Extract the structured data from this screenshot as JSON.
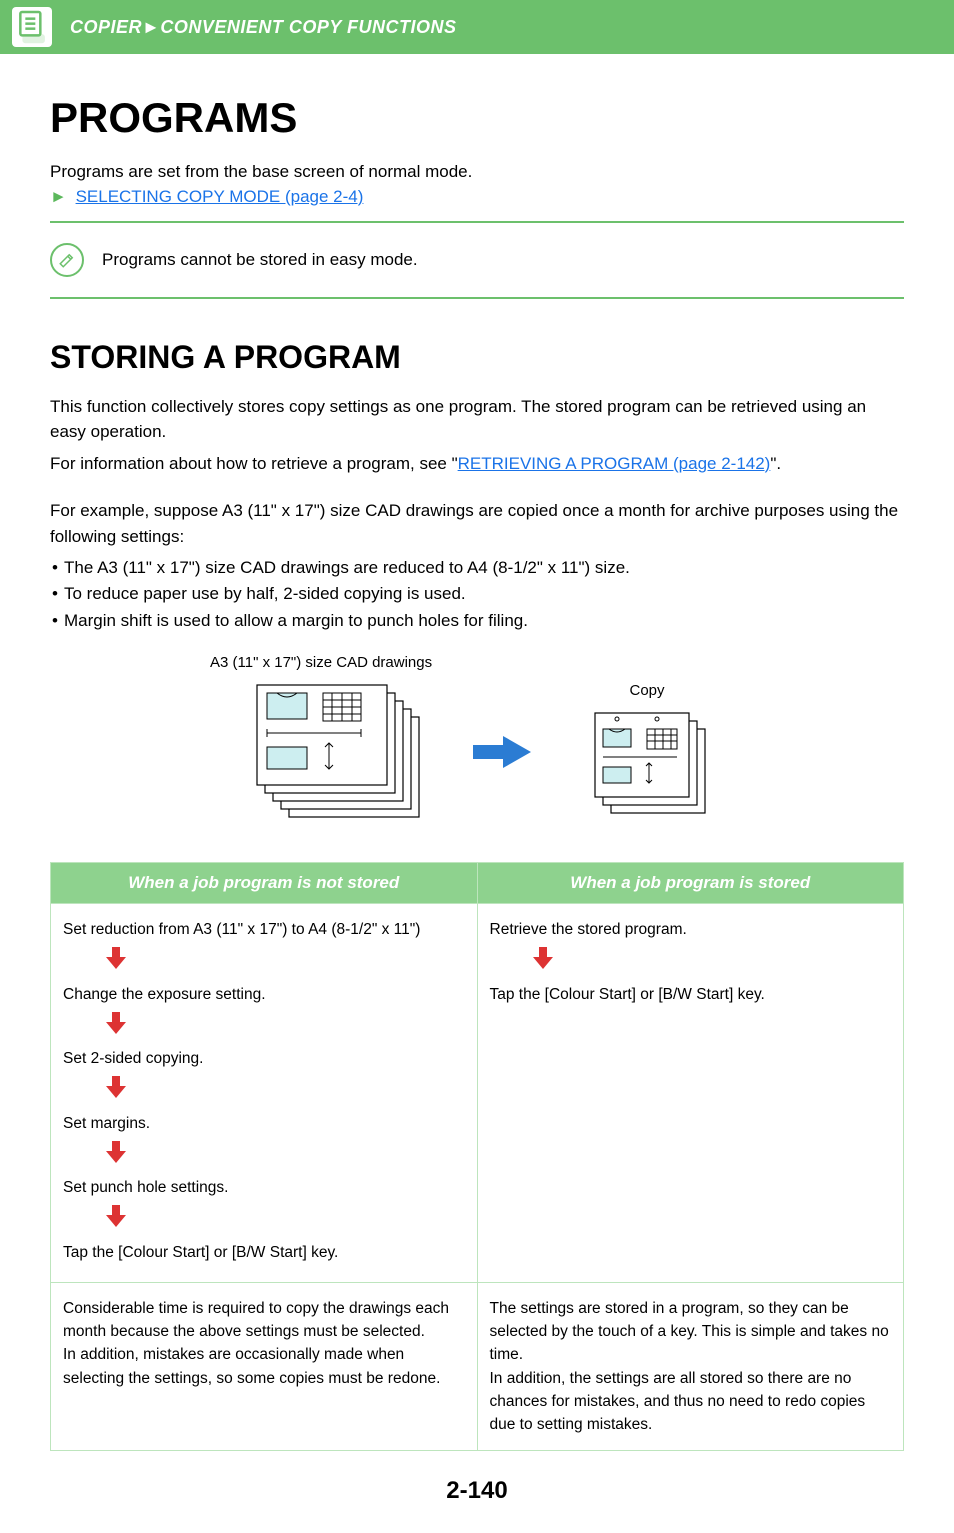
{
  "header": {
    "breadcrumb_parent": "COPIER",
    "breadcrumb_sep": "►",
    "breadcrumb_child": "CONVENIENT COPY FUNCTIONS"
  },
  "title": "PROGRAMS",
  "intro": "Programs are set from the base screen of normal mode.",
  "link_prefix": "►",
  "link_text": "SELECTING COPY MODE (page 2-4)",
  "note": "Programs cannot be stored in easy mode.",
  "section_title": "STORING A PROGRAM",
  "para1": "This function collectively stores copy settings as one program.  The stored program can be retrieved using an easy operation.",
  "para2_prefix": "For information about how to retrieve a program, see \"",
  "para2_link": "RETRIEVING A PROGRAM (page 2-142)",
  "para2_suffix": "\".",
  "example_intro": "For example, suppose A3 (11\" x 17\") size CAD drawings are copied once a month for archive purposes using the following settings:",
  "bullets": [
    "The A3 (11\" x 17\") size CAD drawings are reduced to A4 (8-1/2\" x 11\") size.",
    "To reduce paper use by half, 2-sided copying is used.",
    "Margin shift is used to allow a margin to punch holes for filing."
  ],
  "diagram": {
    "caption_left": "A3 (11\" x 17\") size CAD drawings",
    "caption_right": "Copy"
  },
  "table": {
    "header_left": "When a job program is not stored",
    "header_right": "When a job program is stored",
    "left_steps": [
      "Set reduction from A3 (11\" x 17\") to A4 (8-1/2\" x 11\")",
      "Change the exposure setting.",
      "Set 2-sided copying.",
      "Set margins.",
      "Set punch hole settings.",
      "Tap the [Colour Start] or [B/W Start] key."
    ],
    "right_steps": [
      "Retrieve the stored program.",
      "Tap the [Colour Start] or [B/W Start] key."
    ],
    "left_footer": "Considerable time is required to copy the drawings each month because the above settings must be selected.\nIn addition, mistakes are occasionally made when selecting the settings, so some copies must be redone.",
    "right_footer": "The settings are stored in a program, so they can be selected by the touch of a key. This is simple and takes no time.\nIn addition, the settings are all stored so there are no chances for mistakes, and thus no need to redo copies due to setting mistakes."
  },
  "page_number": "2-140"
}
